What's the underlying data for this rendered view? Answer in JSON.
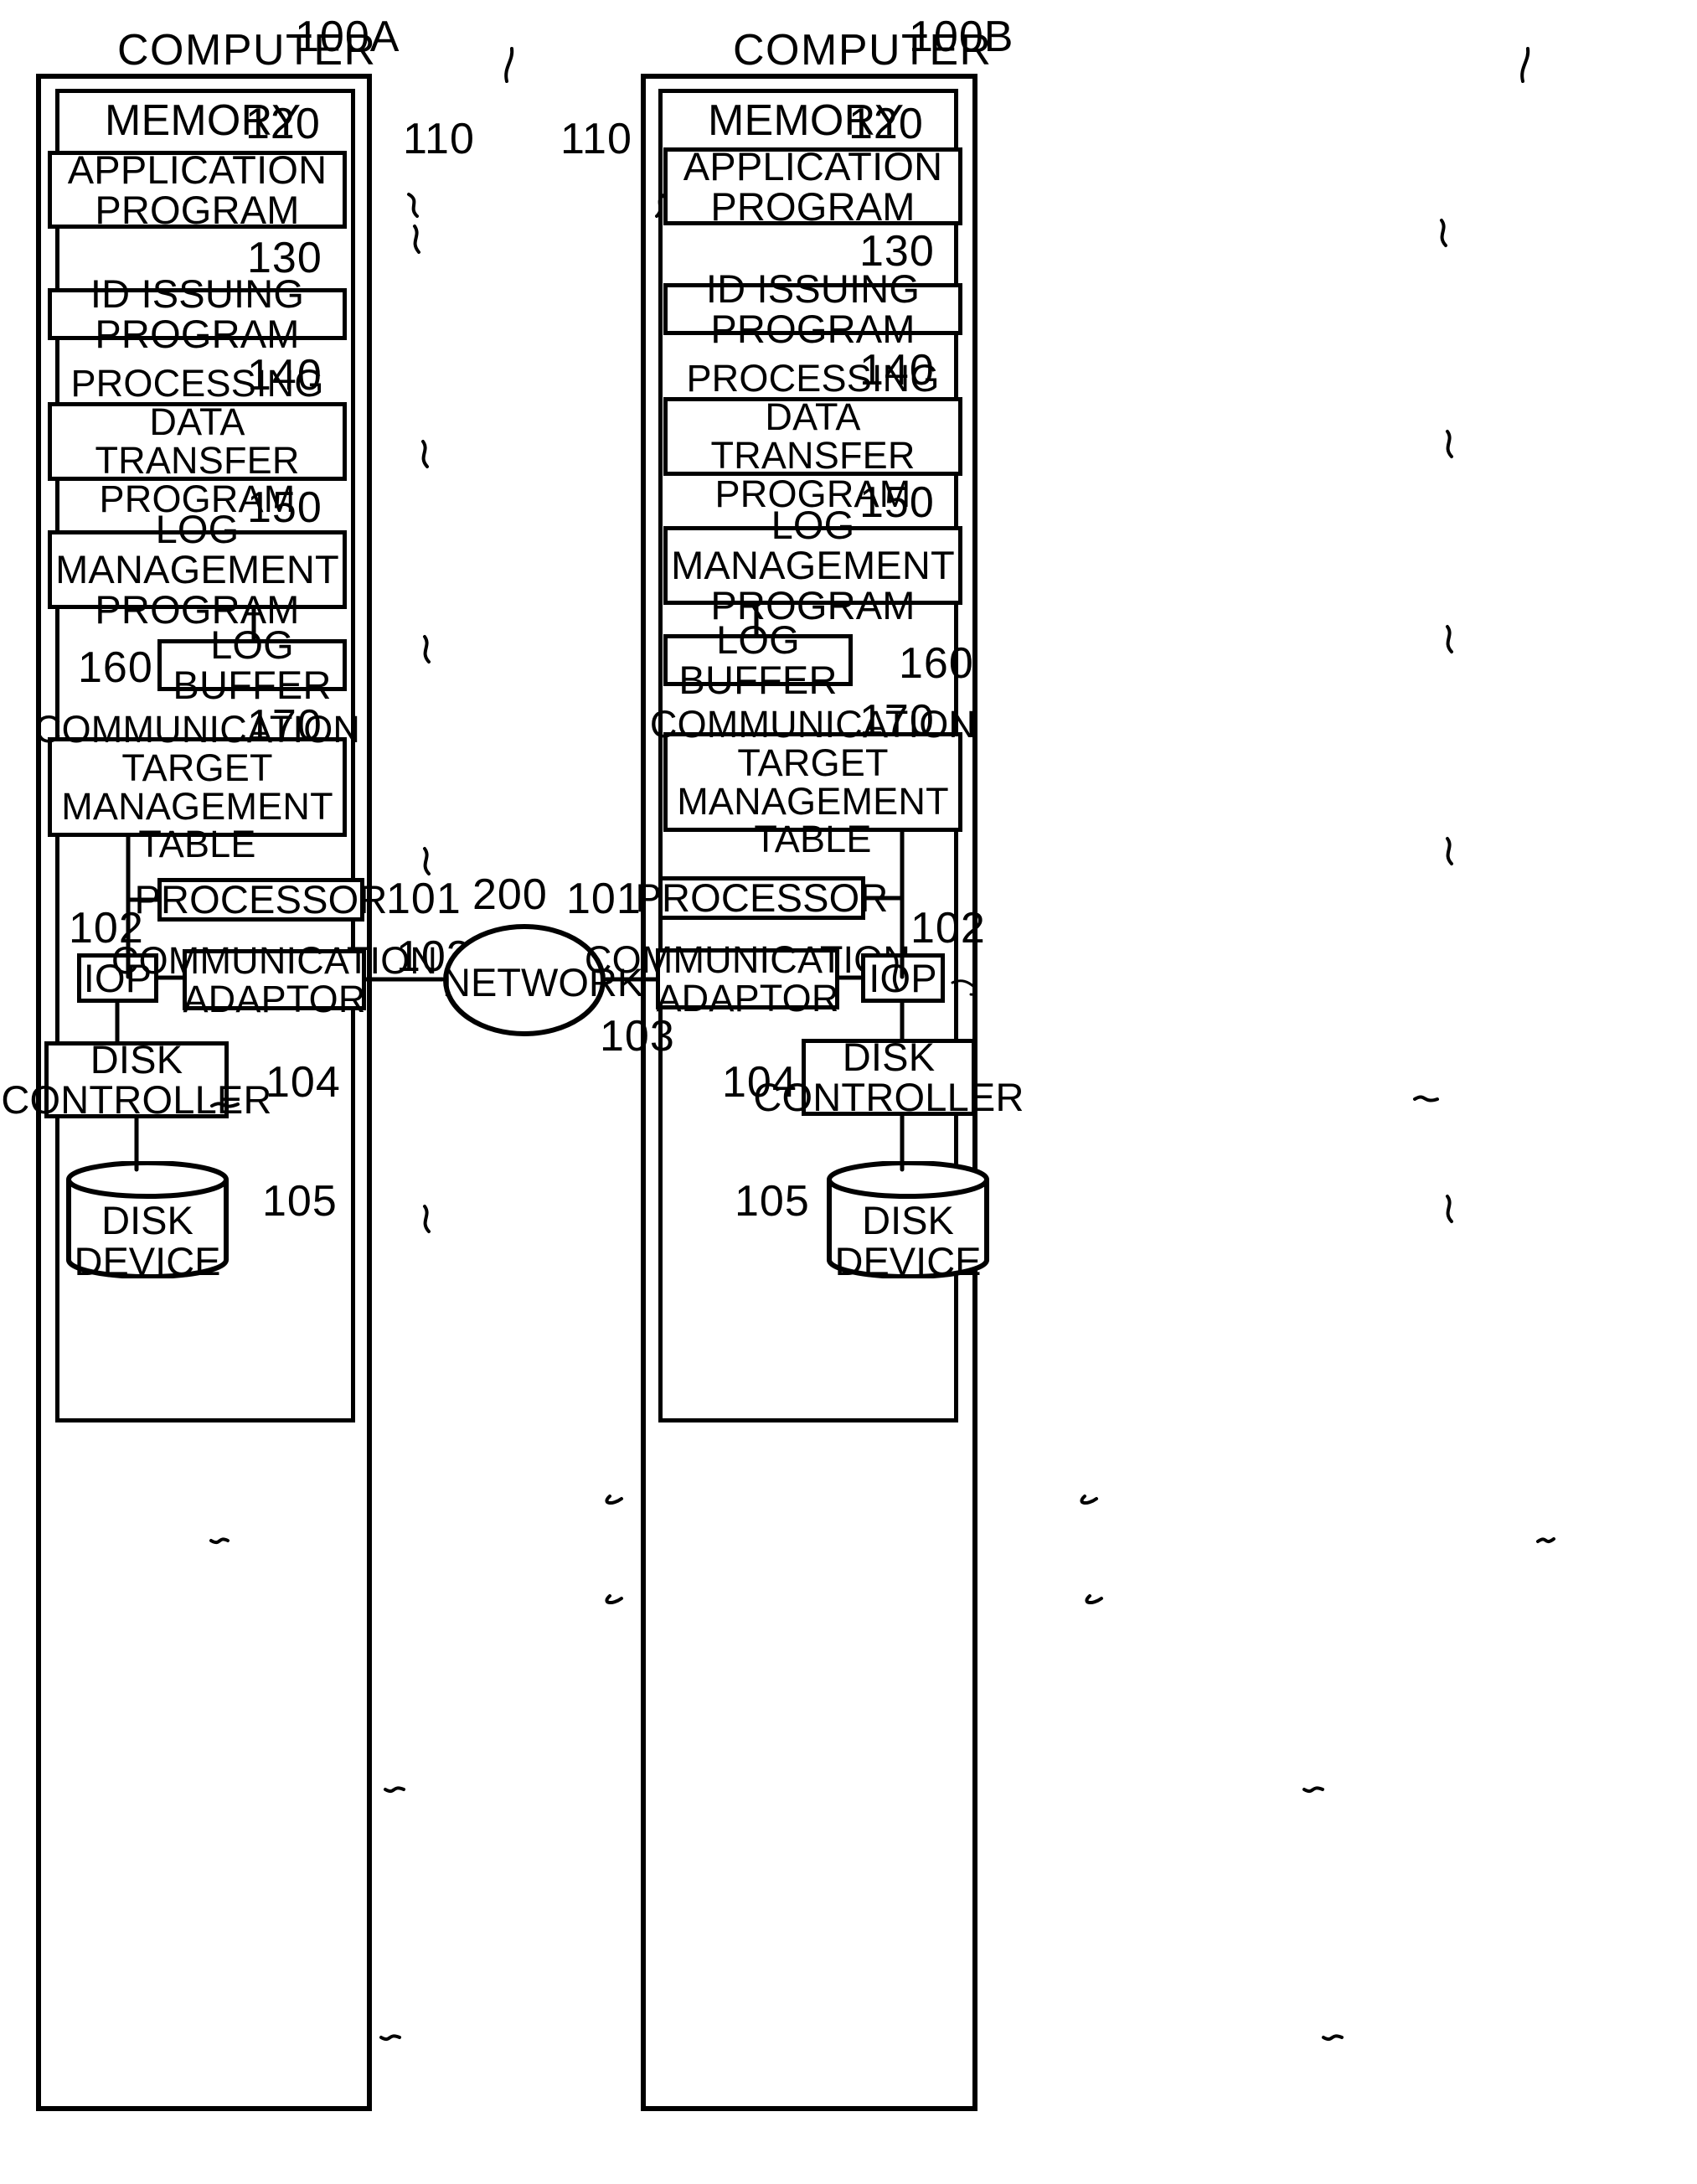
{
  "figure": {
    "type": "patent-block-diagram",
    "computers": [
      {
        "title": "COMPUTER",
        "ref": "100A",
        "memory_ref": "110",
        "memory_label": "MEMORY",
        "memory_ref_num": "120",
        "blocks": [
          {
            "label": "APPLICATION\nPROGRAM",
            "ref": "120"
          },
          {
            "label": "ID ISSUING PROGRAM",
            "ref": "130"
          },
          {
            "label": "PROCESSING DATA\nTRANSFER PROGRAM",
            "ref": "140"
          },
          {
            "label": "LOG MANAGEMENT\nPROGRAM",
            "ref": "150"
          },
          {
            "label": "LOG BUFFER",
            "ref": "160"
          },
          {
            "label": "COMMUNICATION\nTARGET\nMANAGEMENT TABLE",
            "ref": "170"
          }
        ],
        "hardware": [
          {
            "label": "PROCESSOR",
            "ref": "101"
          },
          {
            "label": "IOP",
            "ref": "102"
          },
          {
            "label": "COMMUNICATION\nADAPTOR",
            "ref": "103"
          },
          {
            "label": "DISK\nCONTROLLER",
            "ref": "104"
          },
          {
            "label": "DISK\nDEVICE",
            "ref": "105"
          }
        ]
      },
      {
        "title": "COMPUTER",
        "ref": "100B",
        "memory_ref": "110",
        "memory_label": "MEMORY",
        "memory_ref_num": "120",
        "blocks": [
          {
            "label": "APPLICATION\nPROGRAM",
            "ref": "120"
          },
          {
            "label": "ID ISSUING PROGRAM",
            "ref": "130"
          },
          {
            "label": "PROCESSING DATA\nTRANSFER PROGRAM",
            "ref": "140"
          },
          {
            "label": "LOG MANAGEMENT\nPROGRAM",
            "ref": "150"
          },
          {
            "label": "LOG BUFFER",
            "ref": "160"
          },
          {
            "label": "COMMUNICATION\nTARGET\nMANAGEMENT TABLE",
            "ref": "170"
          }
        ],
        "hardware": [
          {
            "label": "PROCESSOR",
            "ref": "101"
          },
          {
            "label": "IOP",
            "ref": "102"
          },
          {
            "label": "COMMUNICATION\nADAPTOR",
            "ref": "103"
          },
          {
            "label": "DISK\nCONTROLLER",
            "ref": "104"
          },
          {
            "label": "DISK\nDEVICE",
            "ref": "105"
          }
        ]
      }
    ],
    "network": {
      "label": "NETWORK",
      "ref": "200"
    },
    "colors": {
      "ink": "#000000",
      "paper": "#ffffff"
    }
  }
}
